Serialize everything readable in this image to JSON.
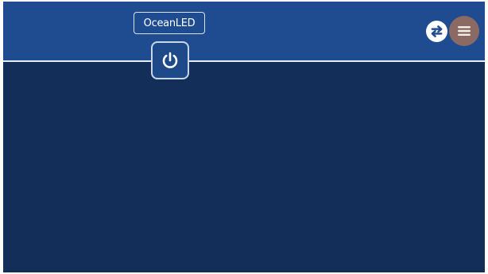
{
  "header": {
    "logo_text": "OceanLED",
    "power_icon": "power-icon",
    "swap_icon": "swap-arrows-icon",
    "menu_icon": "hamburger-menu-icon"
  },
  "colors": {
    "header_background": "#1f4c90",
    "screen_background": "#132e58",
    "menu_button": "#8b6a63",
    "icon_light": "#ffffff"
  }
}
